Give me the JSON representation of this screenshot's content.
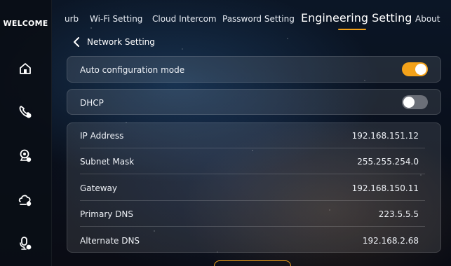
{
  "sidebar": {
    "welcome_label": "WELCOME",
    "icons": [
      "home-icon",
      "phone-icon",
      "camera-icon",
      "cloud-icon",
      "intercom-icon"
    ]
  },
  "tabs": [
    {
      "label": "urb",
      "active": false
    },
    {
      "label": "Wi-Fi Setting",
      "active": false
    },
    {
      "label": "Cloud Intercom",
      "active": false
    },
    {
      "label": "Password Setting",
      "active": false
    },
    {
      "label": "Engineering Setting",
      "active": true
    },
    {
      "label": "About",
      "active": false
    }
  ],
  "header": {
    "back_label": "Network Setting"
  },
  "auto_config": {
    "label": "Auto configuration mode",
    "enabled": true
  },
  "dhcp": {
    "label": "DHCP",
    "enabled": false
  },
  "network": {
    "rows": [
      {
        "label": "IP Address",
        "value": "192.168.151.12"
      },
      {
        "label": "Subnet Mask",
        "value": "255.255.254.0"
      },
      {
        "label": "Gateway",
        "value": "192.168.150.11"
      },
      {
        "label": "Primary DNS",
        "value": "223.5.5.5"
      },
      {
        "label": "Alternate DNS",
        "value": "192.168.2.68"
      }
    ]
  },
  "colors": {
    "accent": "#f3a21a",
    "toggle_off": "#6b6f78",
    "text": "#eef1f6"
  }
}
